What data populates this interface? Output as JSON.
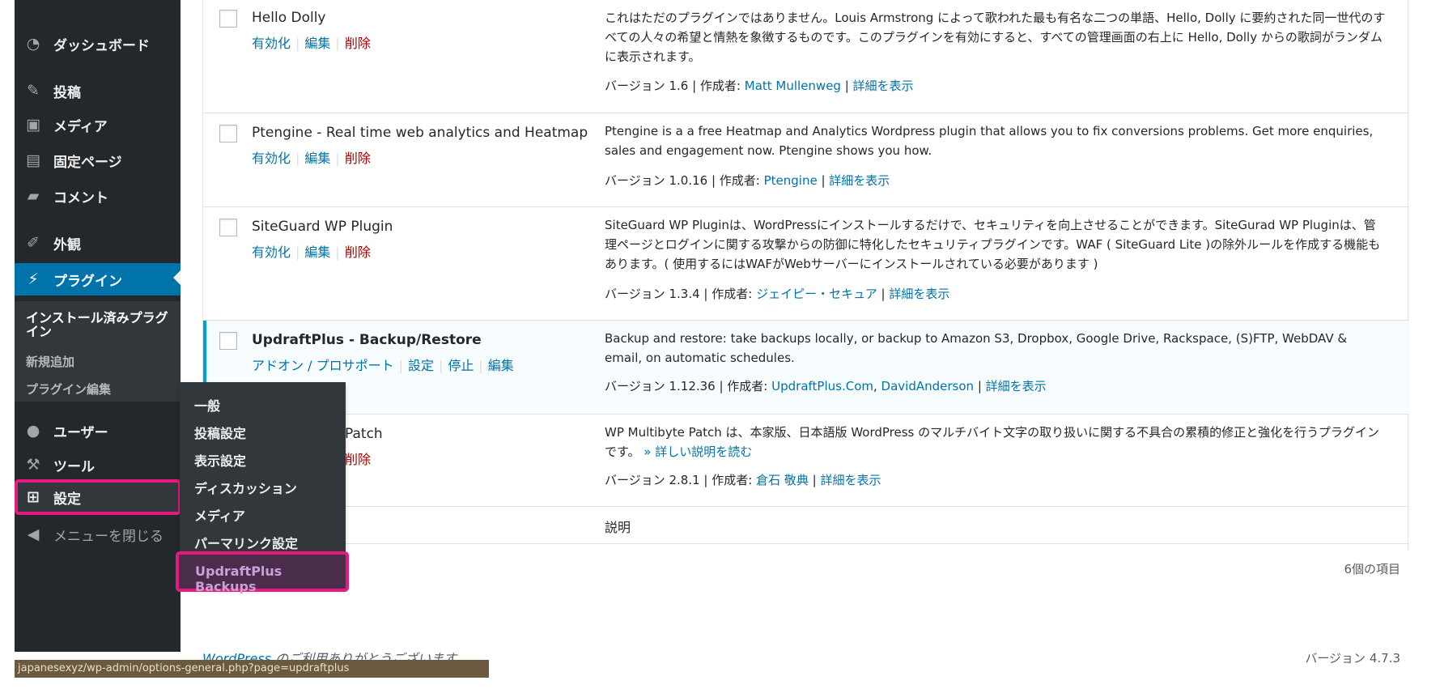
{
  "sidebar": {
    "items": [
      {
        "label": "ダッシュボード",
        "icon": "dashboard-icon"
      },
      {
        "label": "投稿",
        "icon": "pin-icon"
      },
      {
        "label": "メディア",
        "icon": "media-icon"
      },
      {
        "label": "固定ページ",
        "icon": "page-icon"
      },
      {
        "label": "コメント",
        "icon": "comment-icon"
      },
      {
        "label": "外観",
        "icon": "appearance-icon"
      },
      {
        "label": "プラグイン",
        "icon": "plugin-icon"
      },
      {
        "label": "ユーザー",
        "icon": "user-icon"
      },
      {
        "label": "ツール",
        "icon": "wrench-icon"
      },
      {
        "label": "設定",
        "icon": "settings-icon"
      },
      {
        "label": "メニューを閉じる",
        "icon": "collapse-icon"
      }
    ],
    "plugin_submenu": [
      "インストール済みプラグイン",
      "新規追加",
      "プラグイン編集"
    ]
  },
  "flyout": {
    "items": [
      "一般",
      "投稿設定",
      "表示設定",
      "ディスカッション",
      "メディア",
      "パーマリンク設定"
    ],
    "highlighted": "UpdraftPlus Backups"
  },
  "plugins": [
    {
      "name": "Hello Dolly",
      "actions": [
        "有効化",
        "編集",
        "削除"
      ],
      "desc": "これはただのプラグインではありません。Louis Armstrong によって歌われた最も有名な二つの単語、Hello, Dolly に要約された同一世代のすべての人々の希望と情熱を象徴するものです。このプラグインを有効にすると、すべての管理画面の右上に Hello, Dolly からの歌詞がランダムに表示されます。",
      "version": "バージョン 1.6 | 作成者: ",
      "author": "Matt Mullenweg",
      "details": "詳細を表示"
    },
    {
      "name": "Ptengine - Real time web analytics and Heatmap",
      "actions": [
        "有効化",
        "編集",
        "削除"
      ],
      "desc": "Ptengine is a a free Heatmap and Analytics Wordpress plugin that allows you to fix conversions problems. Get more enquiries, sales and engagement now. Ptengine shows you how.",
      "version": "バージョン 1.0.16 | 作成者: ",
      "author": "Ptengine",
      "details": "詳細を表示"
    },
    {
      "name": "SiteGuard WP Plugin",
      "actions": [
        "有効化",
        "編集",
        "削除"
      ],
      "desc": "SiteGuard WP Pluginは、WordPressにインストールするだけで、セキュリティを向上させることができます。SiteGurad WP Pluginは、管理ページとログインに関する攻撃からの防御に特化したセキュリティプラグインです。WAF ( SiteGuard Lite )の除外ルールを作成する機能もあります。( 使用するにはWAFがWebサーバーにインストールされている必要があります )",
      "version": "バージョン 1.3.4 | 作成者: ",
      "author": "ジェイピー・セキュア",
      "details": "詳細を表示"
    },
    {
      "name": "UpdraftPlus - Backup/Restore",
      "actions": [
        "アドオン / プロサポート",
        "設定",
        "停止",
        "編集"
      ],
      "desc": "Backup and restore: take backups locally, or backup to Amazon S3, Dropbox, Google Drive, Rackspace, (S)FTP, WebDAV & email, on automatic schedules.",
      "version": "バージョン 1.12.36 | 作成者: ",
      "author": "UpdraftPlus.Com",
      "author2": "DavidAnderson",
      "details": "詳細を表示"
    },
    {
      "name": "Patch",
      "actions": [
        "削除"
      ],
      "desc": "WP Multibyte Patch は、本家版、日本語版 WordPress のマルチバイト文字の取り扱いに関する不具合の累積的修正と強化を行うプラグインです。",
      "desc_link": "» 詳しい説明を読む",
      "version": "バージョン 2.8.1 | 作成者: ",
      "author": "倉石 敬典",
      "details": "詳細を表示"
    }
  ],
  "footer_col": "説明",
  "item_count": "6個の項目",
  "thanks_link": "WordPress",
  "thanks_text": " のご利用ありがとうございます。",
  "wp_version": "バージョン 4.7.3",
  "status_url": "japanesexyz/wp-admin/options-general.php?page=updraftplus"
}
